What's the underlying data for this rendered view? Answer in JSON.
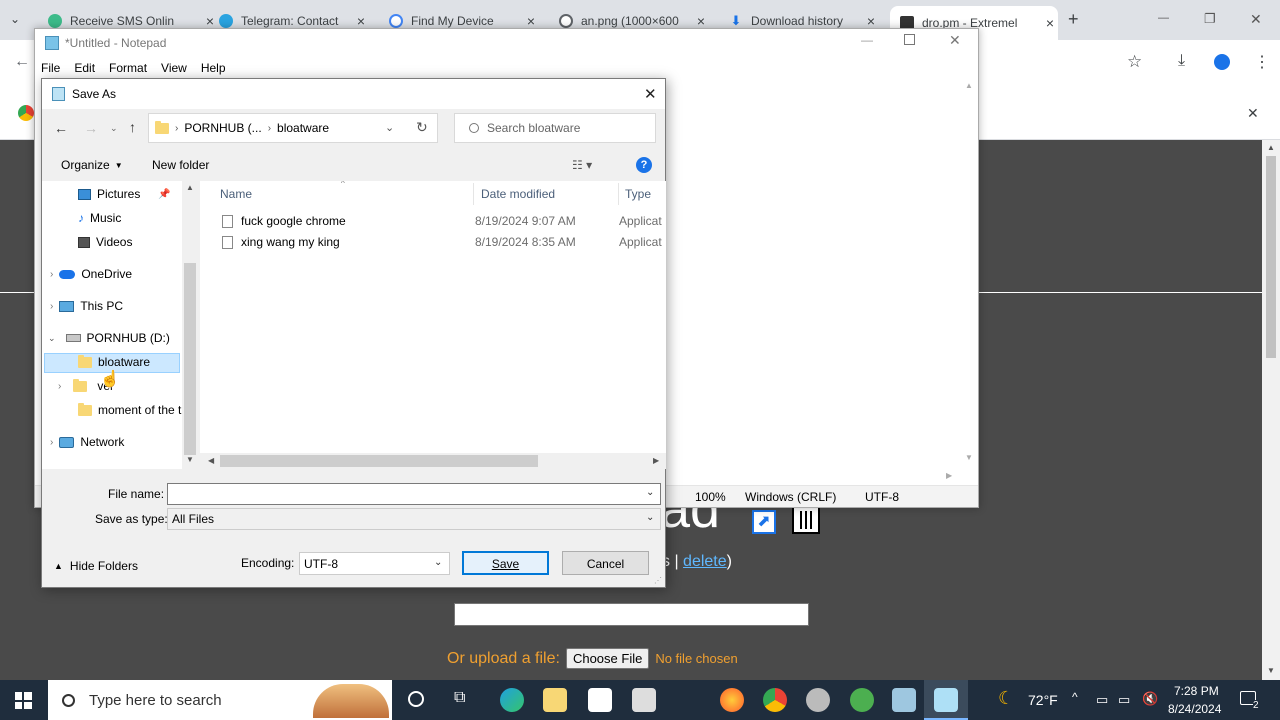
{
  "browser": {
    "tabs": [
      {
        "title": "Receive SMS Onlin",
        "color": "#3dbb8a"
      },
      {
        "title": "Telegram: Contact",
        "color": "#2aa3e0"
      },
      {
        "title": "Find My Device",
        "color": "#4285f4"
      },
      {
        "title": "an.png (1000×600",
        "color": "#5f6368"
      },
      {
        "title": "Download history",
        "color": "#1a73e8"
      },
      {
        "title": "dro.pm - Extremel",
        "color": "#333333"
      }
    ],
    "new_tab": "+",
    "minimize": "—",
    "restore": "❐",
    "close": "✕",
    "banner_close": "✕"
  },
  "page": {
    "heading_partial": "ad",
    "links_partial": "s | ",
    "delete_link": "delete",
    "paren_close": ")",
    "upload_label": "Or upload a file:",
    "choose_file": "Choose File",
    "no_file": "No file chosen"
  },
  "notepad": {
    "title": "*Untitled - Notepad",
    "menu": [
      "File",
      "Edit",
      "Format",
      "View",
      "Help"
    ],
    "status": {
      "zoom": "100%",
      "line_ending": "Windows (CRLF)",
      "encoding": "UTF-8"
    }
  },
  "dialog": {
    "title": "Save As",
    "close": "✕",
    "breadcrumb": [
      "PORNHUB (...",
      "bloatware"
    ],
    "search_placeholder": "Search bloatware",
    "organize": "Organize",
    "new_folder": "New folder",
    "help": "?",
    "tree": [
      {
        "label": "Pictures",
        "indent": 2,
        "icon": "pictures"
      },
      {
        "label": "Music",
        "indent": 2,
        "icon": "music"
      },
      {
        "label": "Videos",
        "indent": 2,
        "icon": "videos"
      },
      {
        "label": "OneDrive",
        "indent": 1,
        "icon": "onedrive"
      },
      {
        "label": "This PC",
        "indent": 1,
        "icon": "pc"
      },
      {
        "label": "PORNHUB (D:)",
        "indent": 1,
        "icon": "drive"
      },
      {
        "label": "bloatware",
        "indent": 2,
        "icon": "folder"
      },
      {
        "label": "ver",
        "indent": 2,
        "icon": "folder"
      },
      {
        "label": "moment of the t",
        "indent": 2,
        "icon": "folder"
      },
      {
        "label": "Network",
        "indent": 1,
        "icon": "network"
      }
    ],
    "columns": {
      "name": "Name",
      "date": "Date modified",
      "type": "Type"
    },
    "files": [
      {
        "name": "fuck google chrome",
        "date": "8/19/2024 9:07 AM",
        "type": "Applicat"
      },
      {
        "name": "xing wang my king",
        "date": "8/19/2024 8:35 AM",
        "type": "Applicat"
      }
    ],
    "file_name_label": "File name:",
    "file_name_value": "",
    "save_as_type_label": "Save as type:",
    "save_as_type_value": "All Files",
    "hide_folders": "Hide Folders",
    "encoding_label": "Encoding:",
    "encoding_value": "UTF-8",
    "save": "Save",
    "cancel": "Cancel"
  },
  "taskbar": {
    "search_placeholder": "Type here to search",
    "weather": "72°F",
    "time": "7:28 PM",
    "date": "8/24/2024",
    "notif_count": "2"
  }
}
